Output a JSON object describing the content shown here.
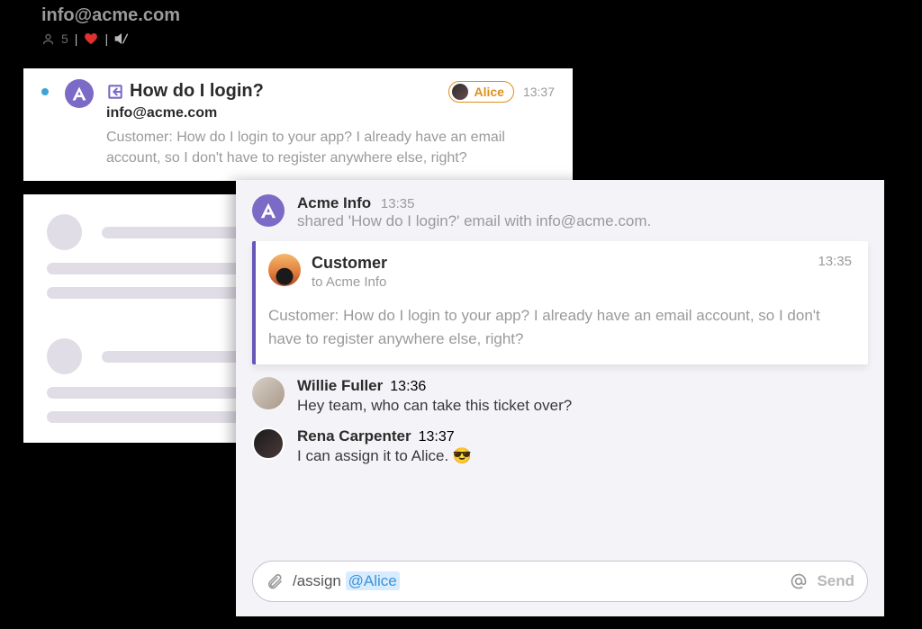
{
  "header": {
    "title": "info@acme.com",
    "people_count": "5"
  },
  "ticket": {
    "subject": "How do I login?",
    "from": "info@acme.com",
    "preview": "Customer: How do I login to your app? I already have an email account, so I don't have to register anywhere else, right?",
    "assignee": "Alice",
    "time": "13:37"
  },
  "chat": {
    "share": {
      "actor": "Acme Info",
      "time": "13:35",
      "text": "shared 'How do I login?' email with info@acme.com."
    },
    "email": {
      "sender": "Customer",
      "to": "to Acme Info",
      "time": "13:35",
      "body": "Customer: How do I login to your app? I already have an email account, so I don't have to register anywhere else, right?"
    },
    "replies": [
      {
        "name": "Willie Fuller",
        "time": "13:36",
        "text": "Hey team, who can take this ticket over?"
      },
      {
        "name": "Rena Carpenter",
        "time": "13:37",
        "text": "I can assign it to Alice. 😎"
      }
    ],
    "composer": {
      "command": "/assign ",
      "mention": "@Alice",
      "send": "Send"
    }
  }
}
